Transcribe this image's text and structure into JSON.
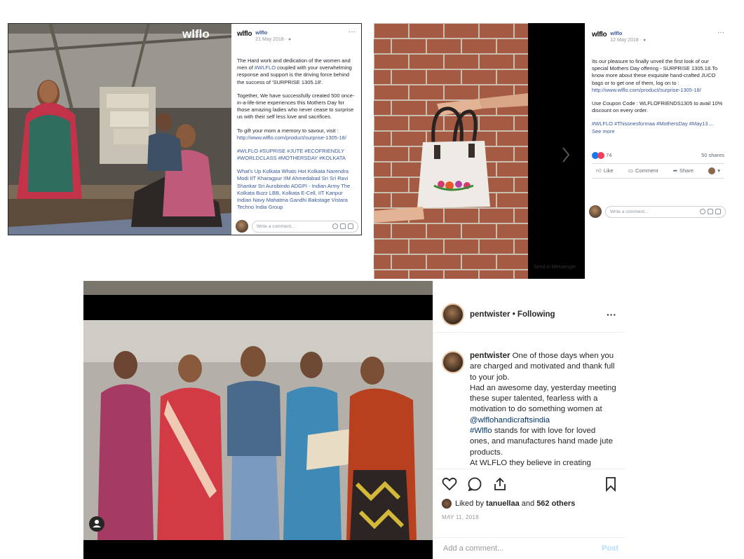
{
  "post1": {
    "brand_logo": "wlflo",
    "page_name": "wlflo",
    "date": "21 May 2018 · ",
    "more": "···",
    "para1_pre": "The Hard work and dedication of the women and men of ",
    "para1_tag": "#WLFLO",
    "para1_post": " coupled with your overwhelming response and support is the driving force behind the success of 'SURPRISE 1305.18'.",
    "para2": "Together, We have successfully created 500 once-in-a-life-time experiences this Mothers Day for those amazing ladies who never cease to surprise us with their self less love and sacrifices.",
    "para3": "To gift your mom a memory to savour, visit :",
    "link": "http://www.wlflo.com/product/surprise-1305-18/",
    "hashtags": "#WLFLO #SUPRISE #JUTE #ECOFRIENDLY #WORLDCLASS #MOTHERSDAY #KOLKATA",
    "tagged": "What's Up Kolkata Whats Hot Kolkata Narendra Modi IIT Kharagpur IIM Ahmedabad Sri Sri Ravi Shankar Sri Aurobindo ADGPI - Indian Army The Kolkata Buzz LBB, Kolkata E-Cell, IIT Kanpur Indian Navy Mahatma Gandhi Bakstage Vistara Techno India Group",
    "comment_placeholder": "Write a comment...",
    "photo_logo": "wlflo"
  },
  "post2": {
    "brand_logo": "wlflo",
    "page_name": "wlflo",
    "date": "12 May 2018 · ",
    "more": "···",
    "para1": "Its our pleasure to finally unveil the first look of our special Mothers Day offering - SURPRISE 1305.18.To know more about these exquisite hand-crafted JUCO bags or to get one of them, log on to :",
    "link": "http://www.wlflo.com/product/surprise-1305-18/",
    "para2": "Use Coupon Code : WLFLOFRIENDS1305 to avail 10% discount on every order.",
    "hashtags": "#WLFLO #Thisonesformaa #MothersDay #May13 ...",
    "see_more": "See more",
    "reaction_count": "74",
    "shares": "50 shares",
    "like": "Like",
    "comment": "Comment",
    "share": "Share",
    "comment_placeholder": "Write a comment...",
    "watermark": "Send in Messenger"
  },
  "instagram": {
    "username": "pentwister",
    "following": " • Following",
    "more": "···",
    "caption_user": "pentwister",
    "caption_1": " One of those days when you are charged and motivated and thank full to your job.",
    "caption_2": "Had an awesome day, yesterday meeting these super talented, fearless with a motivation to do something women at ",
    "mention": "@wlflohandicraftsindia",
    "hashtag": "#Wlflo",
    "caption_3": " stands for with love for loved ones, and manufactures hand made jute products.",
    "caption_4": "At WLFLO they believe in creating",
    "liked_by_prefix": "Liked by ",
    "liked_by_user": "tanuellaa",
    "liked_by_and": " and ",
    "liked_by_count": "562 others",
    "date": "MAY 11, 2018",
    "add_comment": "Add a comment...",
    "post_button": "Post"
  }
}
